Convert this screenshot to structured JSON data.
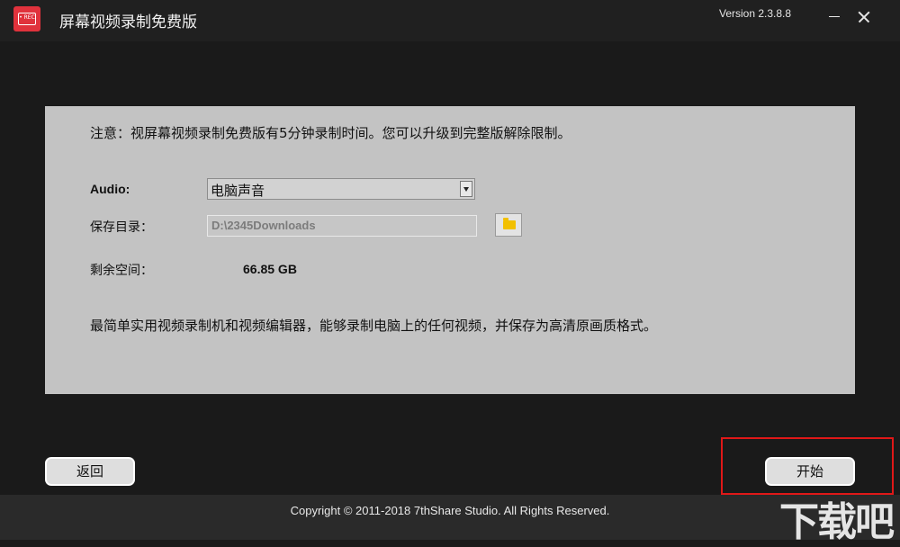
{
  "app": {
    "title": "屏幕视频录制免费版",
    "version": "Version 2.3.8.8",
    "logo_text": "• REC"
  },
  "panel": {
    "notice": "注意：视屏幕视频录制免费版有5分钟录制时间。您可以升级到完整版解除限制。",
    "audio_label": "Audio:",
    "audio_value": "电脑声音",
    "save_dir_label": "保存目录：",
    "save_dir_value": "D:\\2345Downloads",
    "free_space_label": "剩余空间：",
    "free_space_value": "66.85 GB",
    "description": "最简单实用视频录制机和视频编辑器，能够录制电脑上的任何视频，并保存为高清原画质格式。"
  },
  "buttons": {
    "back": "返回",
    "start": "开始"
  },
  "footer": {
    "copyright": "Copyright © 2011-2018 7thShare Studio. All Rights Reserved."
  },
  "watermark": "下载吧",
  "colors": {
    "titlebar": "#202020",
    "background": "#1a1a1a",
    "panel": "#c3c3c3",
    "logo": "#e0323c",
    "highlight": "#e01818",
    "folder": "#f2c000"
  }
}
